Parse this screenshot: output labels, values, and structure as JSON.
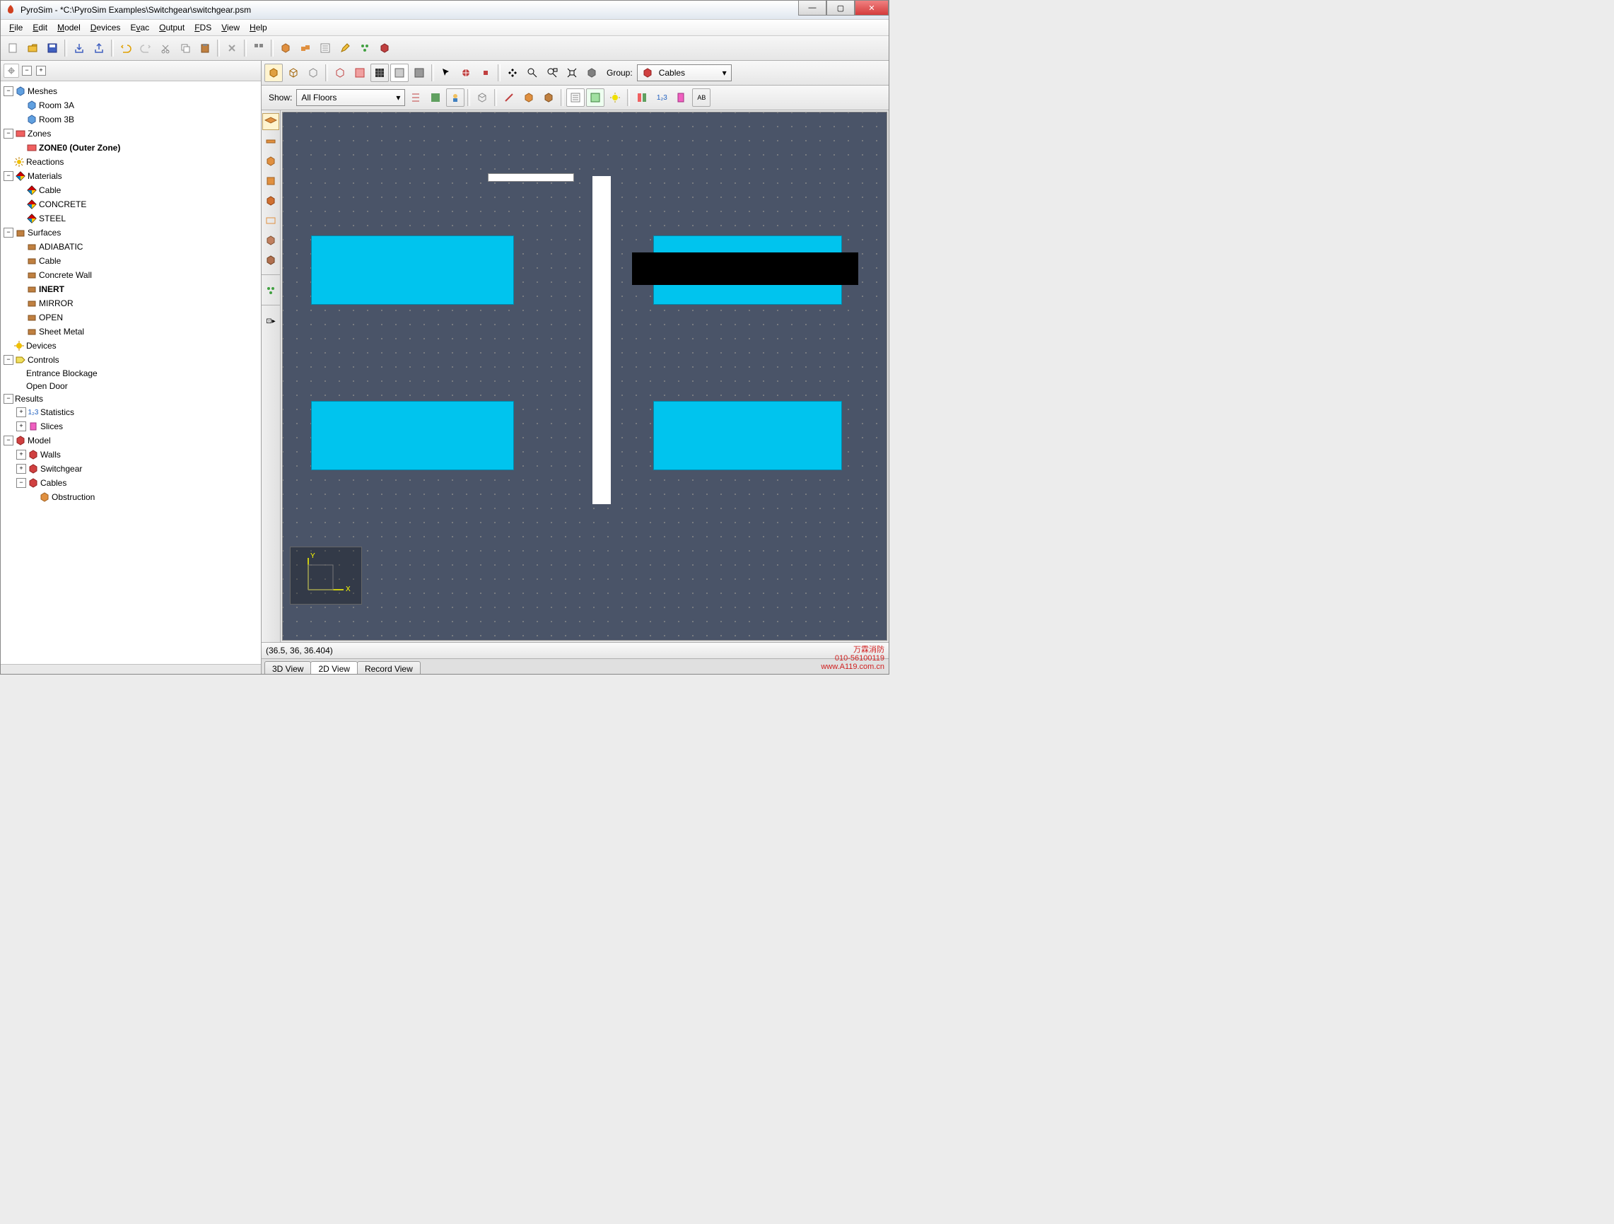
{
  "title": "PyroSim - *C:\\PyroSim Examples\\Switchgear\\switchgear.psm",
  "menu": [
    "File",
    "Edit",
    "Model",
    "Devices",
    "Evac",
    "Output",
    "FDS",
    "View",
    "Help"
  ],
  "group_label": "Group:",
  "group_value": "Cables",
  "show_label": "Show:",
  "show_value": "All Floors",
  "status": "(36.5, 36, 36.404)",
  "tabs": [
    "3D View",
    "2D View",
    "Record View"
  ],
  "active_tab": 1,
  "watermark1": "万霖消防",
  "watermark2": "010-56100119",
  "watermark3": "www.A119.com.cn",
  "tree": {
    "meshes": {
      "label": "Meshes",
      "children": [
        "Room 3A",
        "Room 3B"
      ]
    },
    "zones": {
      "label": "Zones",
      "children": [
        "ZONE0 (Outer Zone)"
      ]
    },
    "reactions": "Reactions",
    "materials": {
      "label": "Materials",
      "children": [
        "Cable",
        "CONCRETE",
        "STEEL"
      ]
    },
    "surfaces": {
      "label": "Surfaces",
      "children": [
        "ADIABATIC",
        "Cable",
        "Concrete Wall",
        "INERT",
        "MIRROR",
        "OPEN",
        "Sheet Metal"
      ]
    },
    "devices": "Devices",
    "controls": {
      "label": "Controls",
      "children": [
        "Entrance Blockage",
        "Open Door"
      ]
    },
    "results": {
      "label": "Results",
      "children": [
        "Statistics",
        "Slices"
      ]
    },
    "model": {
      "label": "Model",
      "children": [
        "Walls",
        "Switchgear",
        "Cables"
      ],
      "cables_child": "Obstruction"
    }
  }
}
